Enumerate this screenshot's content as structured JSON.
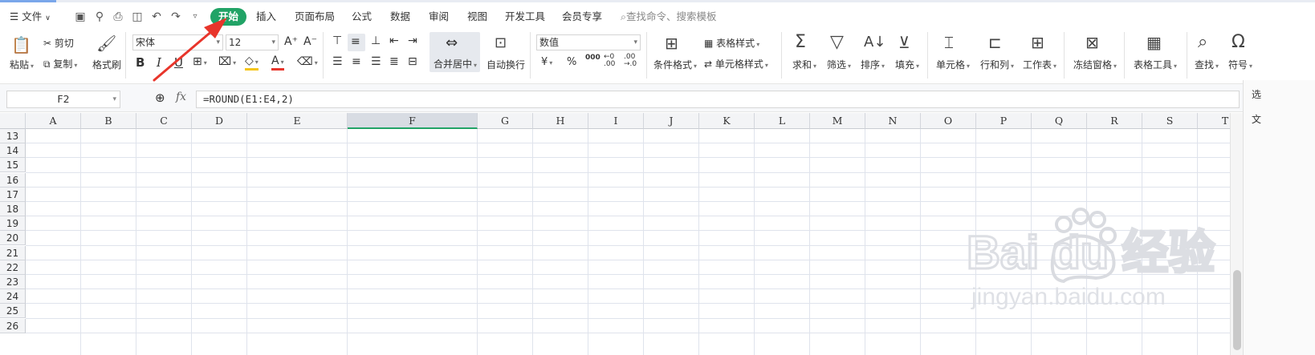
{
  "menu": {
    "file_label": "文件",
    "tabs": [
      "开始",
      "插入",
      "页面布局",
      "公式",
      "数据",
      "审阅",
      "视图",
      "开发工具",
      "会员专享"
    ],
    "active_tab": "开始",
    "search_placeholder": "查找命令、搜索模板"
  },
  "ribbon": {
    "paste": "粘贴",
    "cut": "剪切",
    "copy": "复制",
    "format_painter": "格式刷",
    "font_name": "宋体",
    "font_size": "12",
    "merge_center": "合并居中",
    "wrap_text": "自动换行",
    "number_format": "数值",
    "currency": "¥",
    "percent": "%",
    "thousands": "000",
    "inc_decimal": "←0\n.00",
    "dec_decimal": ".00\n→.0",
    "cond_format": "条件格式",
    "table_style": "表格样式",
    "cell_style": "单元格样式",
    "sum": "求和",
    "filter": "筛选",
    "sort": "排序",
    "fill": "填充",
    "cell": "单元格",
    "row_col": "行和列",
    "worksheet": "工作表",
    "freeze": "冻结窗格",
    "table_tools": "表格工具",
    "find": "查找",
    "symbol": "符号"
  },
  "formula_bar": {
    "cell_ref": "F2",
    "fx": "fx",
    "formula": "=ROUND(E1:E4,2)"
  },
  "sheet": {
    "columns": [
      "A",
      "B",
      "C",
      "D",
      "E",
      "F",
      "G",
      "H",
      "I",
      "J",
      "K",
      "L",
      "M",
      "N",
      "O",
      "P",
      "Q",
      "R",
      "S",
      "T"
    ],
    "selected_column": "F",
    "rows": [
      "13",
      "14",
      "15",
      "16",
      "17",
      "18",
      "19",
      "20",
      "21",
      "22",
      "23",
      "24",
      "25",
      "26"
    ]
  },
  "side_pane": {
    "top_label": "选",
    "second_label": "文"
  },
  "watermark": {
    "brand": "Bai du 经验",
    "url": "jingyan.baidu.com"
  },
  "colors": {
    "accent": "#21a366",
    "arrow": "#e8352b",
    "grid": "#dfe3ec"
  }
}
